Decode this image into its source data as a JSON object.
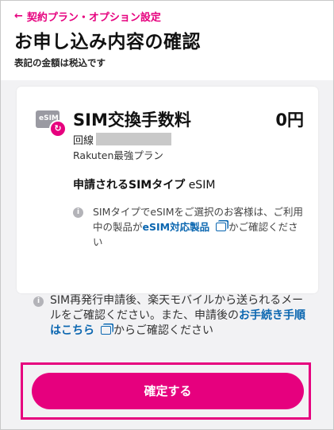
{
  "header": {
    "back_link": "契約プラン・オプション設定",
    "title": "お申し込み内容の確認",
    "subtitle": "表記の金額は税込です"
  },
  "fee_card": {
    "icon_label": "eSIM",
    "name": "SIM交換手数料",
    "price": "0円",
    "line_label": "回線",
    "plan": "Rakuten最強プラン",
    "sim_type_label": "申請されるSIMタイプ",
    "sim_type_value": "eSIM",
    "note_before": "SIMタイプでeSIMをご選択のお客様は、ご利用中の製品が",
    "note_link": "eSIM対応製品",
    "note_after": "かご確認ください"
  },
  "reissue_note": {
    "before": "SIM再発行申請後、楽天モバイルから送られるメールをご確認ください。また、申請後の",
    "link": "お手続き手順はこちら",
    "after": "からご確認ください"
  },
  "confirm_button": "確定する",
  "colors": {
    "accent": "#e6007e",
    "link": "#0a66b0"
  }
}
